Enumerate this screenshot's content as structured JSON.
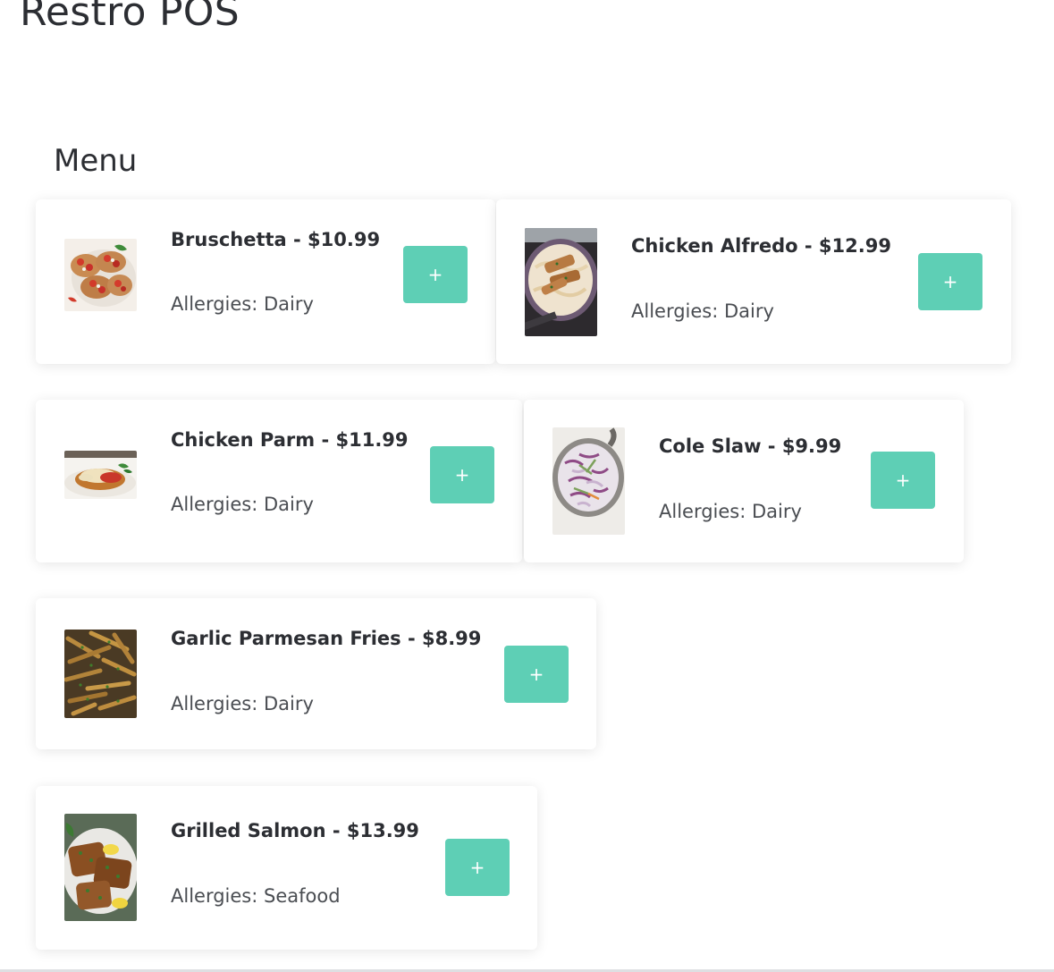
{
  "app": {
    "title": "Restro POS"
  },
  "menu": {
    "heading": "Menu",
    "add_label": "+",
    "items": [
      {
        "name": "Bruschetta",
        "price": "$10.99",
        "name_price": "Bruschetta - $10.99",
        "allergies": "Allergies: Dairy",
        "image_icon": "bruschetta-food-photo"
      },
      {
        "name": "Chicken Alfredo",
        "price": "$12.99",
        "name_price": "Chicken Alfredo - $12.99",
        "allergies": "Allergies: Dairy",
        "image_icon": "chicken-alfredo-food-photo"
      },
      {
        "name": "Chicken Parm",
        "price": "$11.99",
        "name_price": "Chicken Parm - $11.99",
        "allergies": "Allergies: Dairy",
        "image_icon": "chicken-parm-food-photo"
      },
      {
        "name": "Cole Slaw",
        "price": "$9.99",
        "name_price": "Cole Slaw - $9.99",
        "allergies": "Allergies: Dairy",
        "image_icon": "cole-slaw-food-photo"
      },
      {
        "name": "Garlic Parmesan Fries",
        "price": "$8.99",
        "name_price": "Garlic Parmesan Fries - $8.99",
        "allergies": "Allergies: Dairy",
        "image_icon": "garlic-fries-food-photo"
      },
      {
        "name": "Grilled Salmon",
        "price": "$13.99",
        "name_price": "Grilled Salmon - $13.99",
        "allergies": "Allergies: Seafood",
        "image_icon": "grilled-salmon-food-photo"
      }
    ]
  },
  "colors": {
    "accent": "#5ecfb5",
    "text": "#2c2e33",
    "muted_text": "#4a4d52",
    "card_bg": "#ffffff"
  }
}
